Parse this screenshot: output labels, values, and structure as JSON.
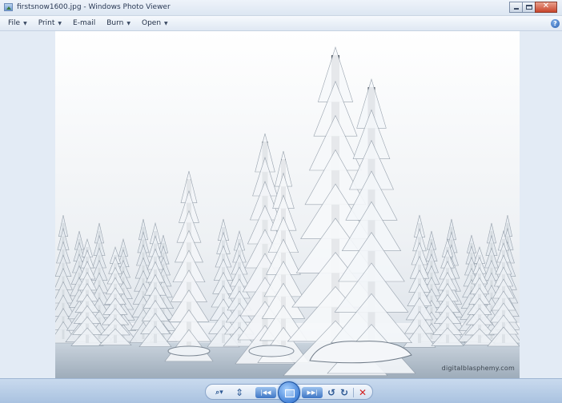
{
  "window": {
    "title": "firstsnow1600.jpg - Windows Photo Viewer",
    "close_glyph": "✕"
  },
  "menu": {
    "items": [
      {
        "label": "File",
        "has_arrow": true
      },
      {
        "label": "Print",
        "has_arrow": true
      },
      {
        "label": "E-mail",
        "has_arrow": false
      },
      {
        "label": "Burn",
        "has_arrow": true
      },
      {
        "label": "Open",
        "has_arrow": true
      }
    ],
    "arrow_glyph": "▼",
    "help_glyph": "?"
  },
  "photo": {
    "watermark": "digitalblasphemy.com",
    "description_icon": "snowy-pine-forest-image"
  },
  "toolbar": {
    "zoom_glyph": "⌕▾",
    "fit_glyph": "⇕",
    "prev_glyph": "|◀◀",
    "next_glyph": "▶▶|",
    "rotate_left_glyph": "↺",
    "rotate_right_glyph": "↻",
    "delete_glyph": "✕"
  },
  "colors": {
    "chrome": "#dfe8f3",
    "accent": "#2e5a95",
    "delete": "#d22323"
  }
}
